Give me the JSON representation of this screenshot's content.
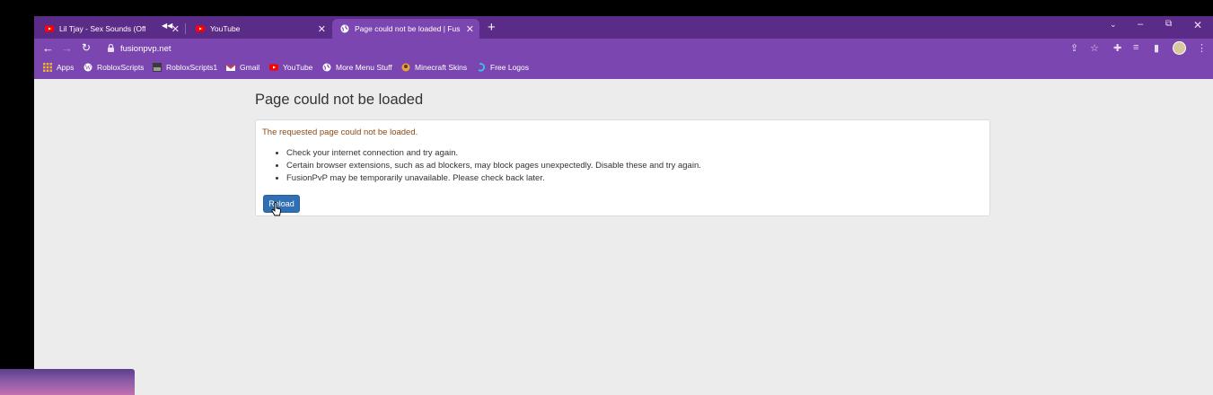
{
  "tabs": [
    {
      "title": "Lil Tjay - Sex Sounds (Official",
      "favicon": "youtube-icon",
      "audio": "mute-icon"
    },
    {
      "title": "YouTube",
      "favicon": "youtube-icon"
    },
    {
      "title": "Page could not be loaded | FusionPvP",
      "favicon": "globe-icon",
      "active": true
    }
  ],
  "address_bar": {
    "url": "fusionpvp.net"
  },
  "bookmarks": [
    {
      "label": "Apps",
      "icon": "apps-grid-icon"
    },
    {
      "label": "RobloxScripts",
      "icon": "wordpress-icon"
    },
    {
      "label": "RobloxScripts1",
      "icon": "image-icon"
    },
    {
      "label": "Gmail",
      "icon": "gmail-icon"
    },
    {
      "label": "YouTube",
      "icon": "youtube-icon"
    },
    {
      "label": "More Menu Stuff",
      "icon": "globe-icon"
    },
    {
      "label": "Minecraft Skins",
      "icon": "minecraft-icon"
    },
    {
      "label": "Free Logos",
      "icon": "logo-icon"
    }
  ],
  "page": {
    "title": "Page could not be loaded",
    "message": "The requested page could not be loaded.",
    "suggestions": [
      "Check your internet connection and try again.",
      "Certain browser extensions, such as ad blockers, may block pages unexpectedly. Disable these and try again.",
      "FusionPvP may be temporarily unavailable. Please check back later."
    ],
    "reload_label": "Reload"
  },
  "colors": {
    "tabstrip": "#5b2c87",
    "toolbar": "#7b46b0",
    "button": "#2f6fb3",
    "message": "#8a4a17"
  }
}
